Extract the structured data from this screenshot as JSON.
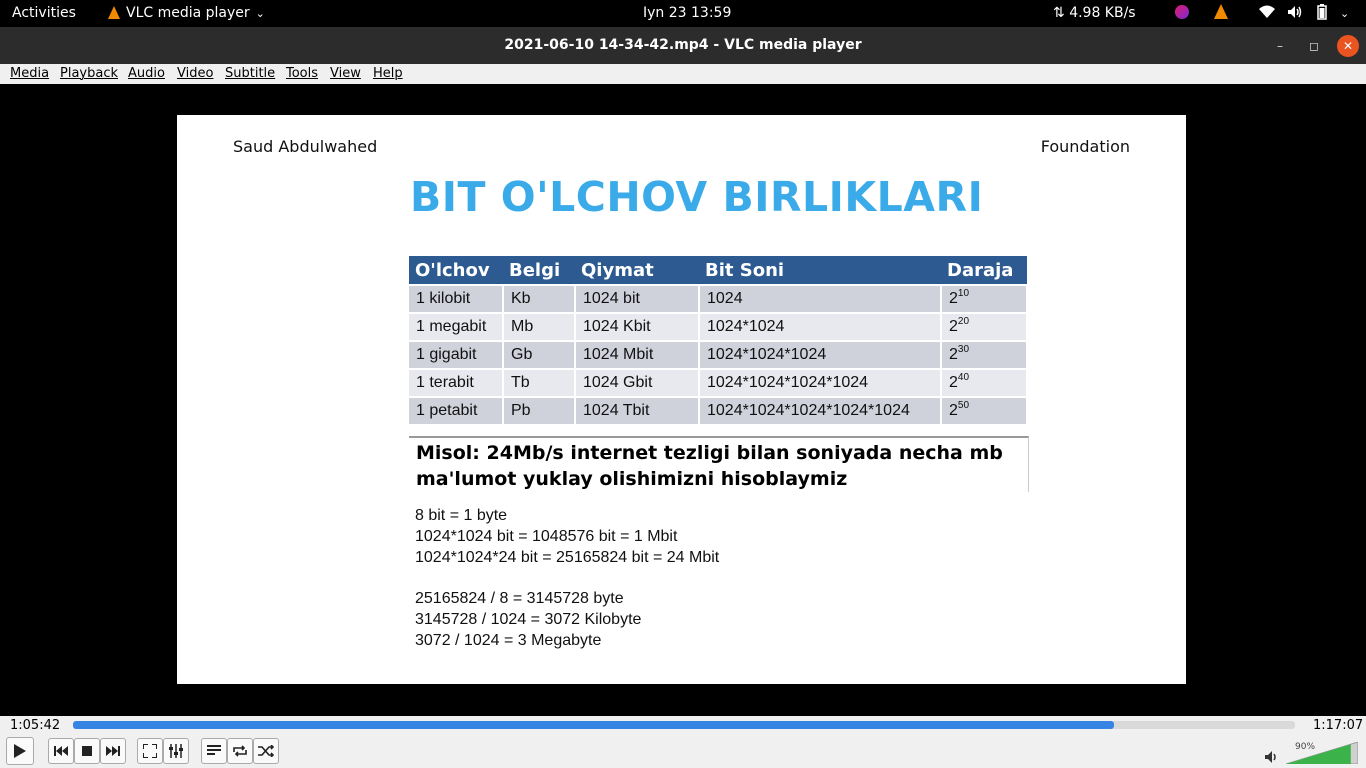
{
  "topbar": {
    "activities": "Activities",
    "app_name": "VLC media player",
    "clock": "Iyn 23  13:59",
    "net_speed": "4.98 KB/s"
  },
  "window": {
    "title": "2021-06-10 14-34-42.mp4 - VLC media player"
  },
  "menu": [
    "Media",
    "Playback",
    "Audio",
    "Video",
    "Subtitle",
    "Tools",
    "View",
    "Help"
  ],
  "slide": {
    "left_header": "Saud Abdulwahed",
    "right_header": "Foundation",
    "title": "BIT O'LCHOV BIRLIKLARI",
    "table": {
      "headers": [
        "O'lchov",
        "Belgi",
        "Qiymat",
        "Bit Soni",
        "Daraja"
      ],
      "rows": [
        {
          "olchov": "1 kilobit",
          "belgi": "Kb",
          "qiymat": "1024 bit",
          "bit_soni": "1024",
          "daraja_base": "2",
          "daraja_exp": "10"
        },
        {
          "olchov": "1 megabit",
          "belgi": "Mb",
          "qiymat": "1024 Kbit",
          "bit_soni": "1024*1024",
          "daraja_base": "2",
          "daraja_exp": "20"
        },
        {
          "olchov": "1 gigabit",
          "belgi": "Gb",
          "qiymat": "1024 Mbit",
          "bit_soni": "1024*1024*1024",
          "daraja_base": "2",
          "daraja_exp": "30"
        },
        {
          "olchov": "1 terabit",
          "belgi": "Tb",
          "qiymat": "1024 Gbit",
          "bit_soni": "1024*1024*1024*1024",
          "daraja_base": "2",
          "daraja_exp": "40"
        },
        {
          "olchov": "1 petabit",
          "belgi": "Pb",
          "qiymat": "1024 Tbit",
          "bit_soni": "1024*1024*1024*1024*1024",
          "daraja_base": "2",
          "daraja_exp": "50"
        }
      ]
    },
    "misol_line1": "Misol: 24Mb/s internet tezligi bilan soniyada necha mb",
    "misol_line2": "ma'lumot yuklay olishimizni hisoblaymiz",
    "calc_lines_a": [
      "8 bit = 1 byte",
      "1024*1024 bit = 1048576 bit = 1 Mbit",
      "1024*1024*24 bit = 25165824 bit = 24 Mbit"
    ],
    "calc_lines_b": [
      "25165824 / 8 = 3145728 byte",
      "3145728 / 1024 = 3072 Kilobyte",
      "3072 / 1024 = 3 Megabyte"
    ]
  },
  "player": {
    "elapsed": "1:05:42",
    "total": "1:17:07",
    "progress_fraction": 0.852,
    "volume_label": "90%",
    "volume_fraction": 0.9
  },
  "colors": {
    "accent": "#3584e4",
    "slide_title": "#3aabe8",
    "table_header": "#2d5b91"
  }
}
